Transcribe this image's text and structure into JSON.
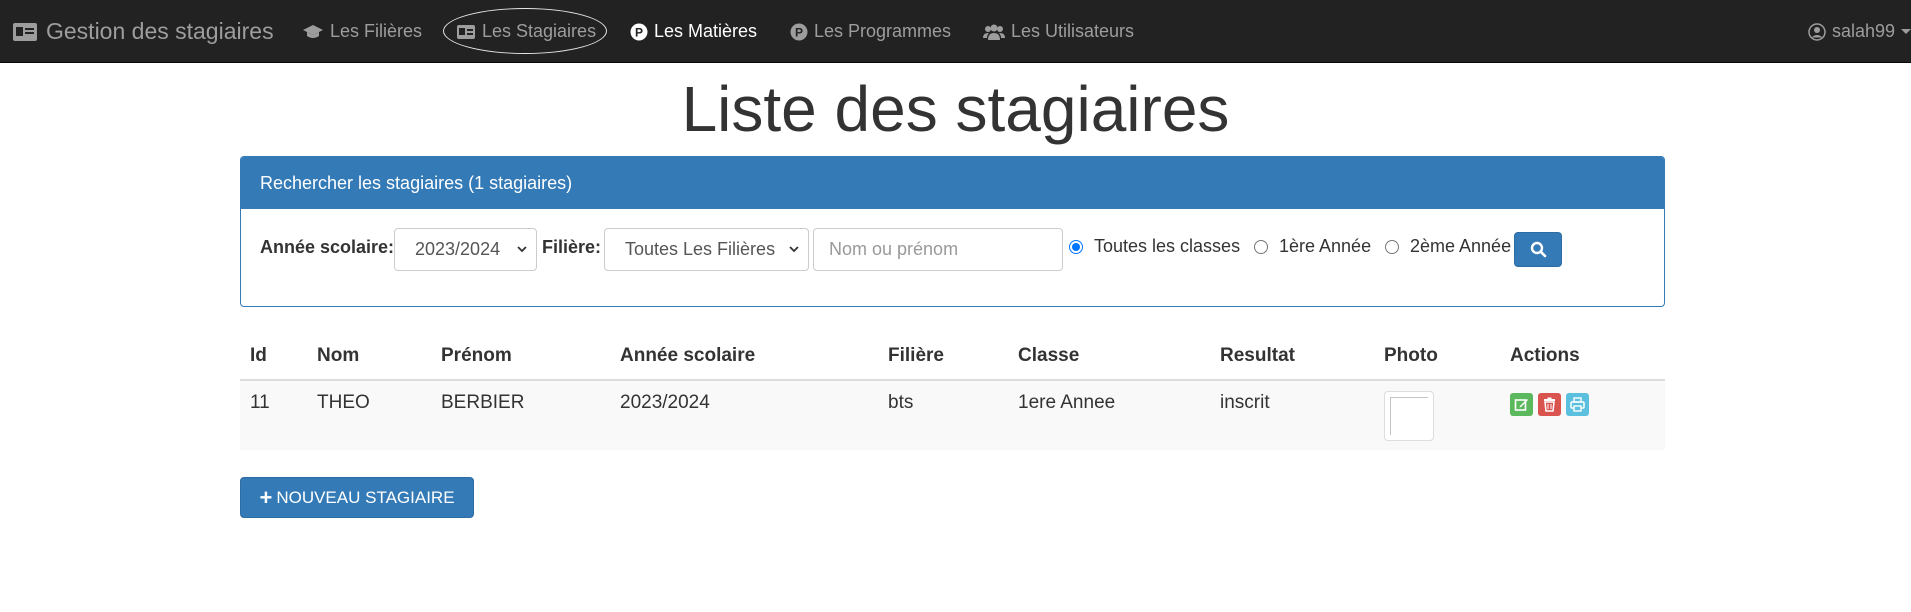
{
  "navbar": {
    "brand": "Gestion des stagiaires",
    "items": [
      {
        "label": "Les Filières",
        "icon": "graduation-cap-icon"
      },
      {
        "label": "Les Stagiaires",
        "icon": "id-card-icon"
      },
      {
        "label": "Les Matières",
        "icon": "p-circle-icon"
      },
      {
        "label": "Les Programmes",
        "icon": "p-circle-icon"
      },
      {
        "label": "Les Utilisateurs",
        "icon": "users-icon"
      }
    ],
    "active_item": "Les Matières",
    "highlighted_item": "Les Stagiaires",
    "user": "salah99",
    "user_icon": "user-circle-icon"
  },
  "page": {
    "title": "Liste des stagiaires"
  },
  "search_panel": {
    "heading": "Rechercher les stagiaires (1 stagiaires)",
    "annee_label": "Année scolaire:",
    "annee_value": "2023/2024",
    "filiere_label": "Filière:",
    "filiere_value": "Toutes Les Filières",
    "name_placeholder": "Nom ou prénom",
    "radios": [
      {
        "label": "Toutes les classes",
        "checked": true
      },
      {
        "label": "1ère Année",
        "checked": false
      },
      {
        "label": "2ème Année",
        "checked": false
      }
    ],
    "search_icon": "search-icon"
  },
  "table": {
    "headers": [
      "Id",
      "Nom",
      "Prénom",
      "Année scolaire",
      "Filière",
      "Classe",
      "Resultat",
      "Photo",
      "Actions"
    ],
    "rows": [
      {
        "id": "11",
        "nom": "THEO",
        "prenom": "BERBIER",
        "annee": "2023/2024",
        "filiere": "bts",
        "classe": "1ere Annee",
        "resultat": "inscrit"
      }
    ],
    "action_icons": [
      "edit-icon",
      "trash-icon",
      "print-icon"
    ]
  },
  "new_button": {
    "label": "NOUVEAU STAGIAIRE"
  },
  "colors": {
    "navbar_bg": "#222222",
    "primary": "#337ab7",
    "success": "#5cb85c",
    "danger": "#d9534f",
    "info": "#5bc0de"
  }
}
